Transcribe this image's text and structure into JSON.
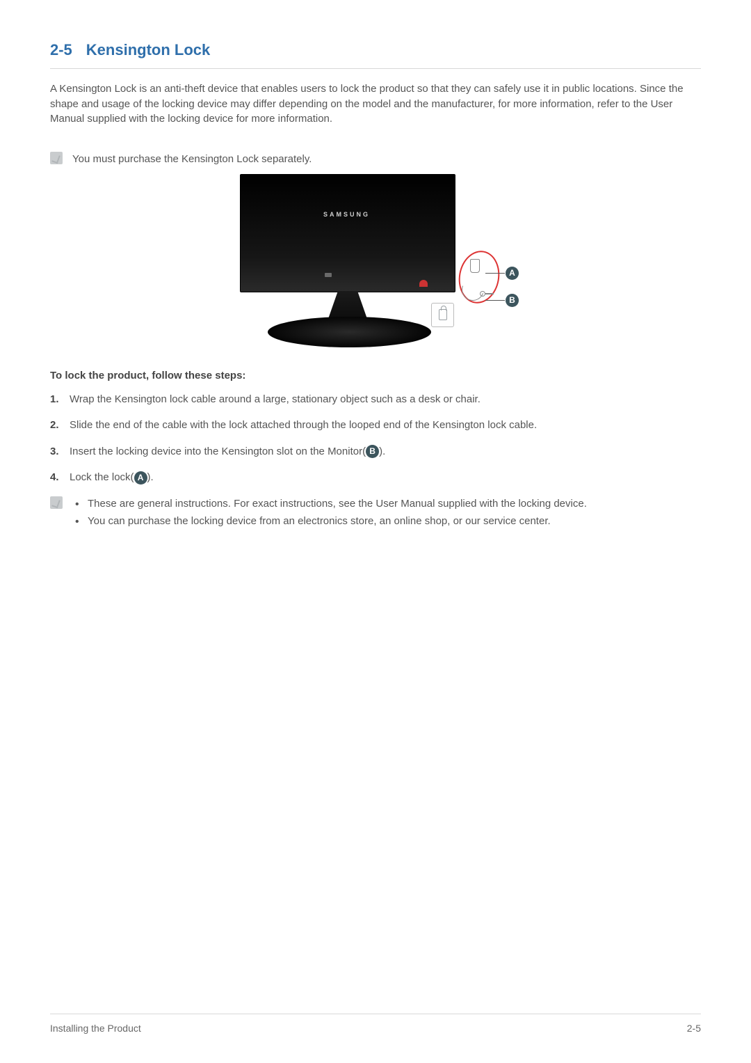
{
  "heading": {
    "number": "2-5",
    "title": "Kensington Lock"
  },
  "intro": "A Kensington Lock is an anti-theft device that enables users to lock the product so that they can safely use it in public locations. Since the shape and usage of the locking device may differ depending on the model and the manufacturer, for more information, refer to the User Manual supplied with the locking device for more information.",
  "note1": "You must purchase the Kensington Lock separately.",
  "figure": {
    "brand": "SAMSUNG",
    "marker_a": "A",
    "marker_b": "B"
  },
  "steps_heading": "To lock the product, follow these steps:",
  "steps": {
    "s1": "Wrap the Kensington lock cable around a large, stationary object such as a desk or chair.",
    "s2": "Slide the end of the cable with the lock attached through the looped end of the Kensington lock cable.",
    "s3_pre": "Insert the locking device into the Kensington slot on the Monitor(",
    "s3_badge": "B",
    "s3_post": ").",
    "s4_pre": "Lock the lock(",
    "s4_badge": "A",
    "s4_post": ")."
  },
  "closing_notes": {
    "n1": "These are general instructions. For exact instructions, see the User Manual supplied with the locking device.",
    "n2": "You can purchase the locking device from an electronics store, an online shop, or our service center."
  },
  "footer": {
    "left": "Installing the Product",
    "right": "2-5"
  }
}
